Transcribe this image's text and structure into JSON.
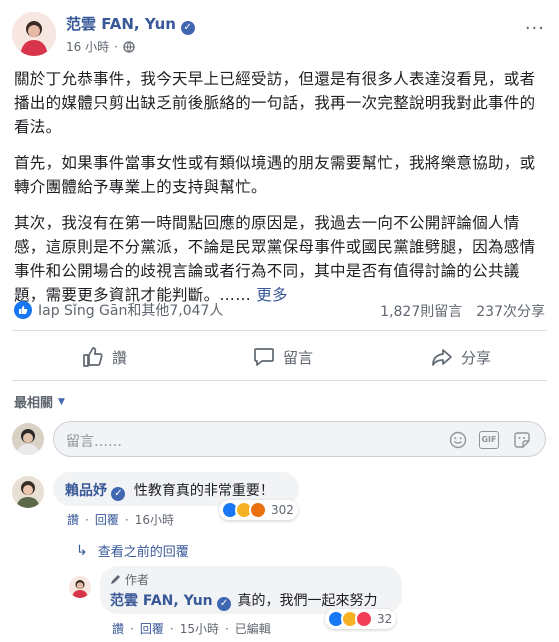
{
  "post": {
    "author": "范雲 FAN, Yun",
    "time": "16 小時",
    "paragraphs": [
      "關於丁允恭事件，我今天早上已經受訪，但還是有很多人表達沒看見，或者播出的媒體只剪出缺乏前後脈絡的一句話，我再一次完整說明我對此事件的看法。",
      "首先，如果事件當事女性或有類似境遇的朋友需要幫忙，我將樂意協助，或轉介團體給予專業上的支持與幫忙。",
      "其次，我沒有在第一時間點回應的原因是，我過去一向不公開評論個人情感，這原則是不分黨派，不論是民眾黨保母事件或國民黨誰劈腿，因為感情事件和公開場合的歧視言論或者行為不同，其中是否有值得討論的公共議題，需要更多資訊才能判斷。……"
    ],
    "more_label": "更多",
    "reactions_text": "Iap Sǐng Gān和其他7,047人",
    "comments_count": "1,827則留言",
    "shares_count": "237次分享"
  },
  "actions": {
    "like": "讚",
    "comment": "留言",
    "share": "分享"
  },
  "sort_label": "最相關",
  "composer": {
    "placeholder": "留言……"
  },
  "comment1": {
    "author": "賴品妤",
    "text": "性教育真的非常重要！",
    "reaction_count": "302",
    "like": "讚",
    "reply": "回覆",
    "time": "16小時"
  },
  "view_previous": "查看之前的回覆",
  "reply1": {
    "badge": "作者",
    "author": "范雲 FAN, Yun",
    "text": "真的，我們一起來努力",
    "reaction_count": "32",
    "like": "讚",
    "reply": "回覆",
    "time": "15小時",
    "edited": "已編輯"
  },
  "colors": {
    "link": "#385898",
    "blue": "#4267b2",
    "grey": "#606770",
    "bubble": "#f2f3f5"
  }
}
